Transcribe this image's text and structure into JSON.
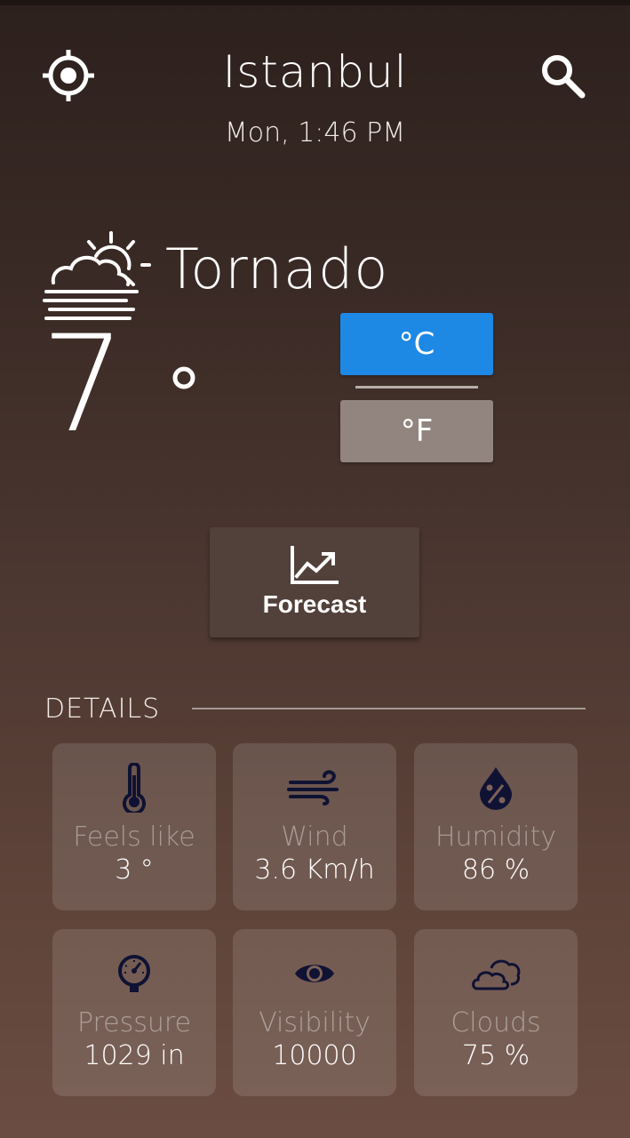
{
  "header": {
    "city": "Istanbul",
    "datetime": "Mon, 1:46 PM",
    "locate_icon": "my-location-icon",
    "search_icon": "search-icon"
  },
  "current": {
    "condition": "Tornado",
    "condition_icon": "sun-behind-fog-icon",
    "temperature": "7",
    "degree_symbol": "°"
  },
  "units": {
    "celsius_label": "°C",
    "fahrenheit_label": "°F",
    "selected": "celsius"
  },
  "forecast": {
    "label": "Forecast",
    "icon": "trending-chart-icon"
  },
  "details": {
    "title": "DETAILS",
    "items": [
      {
        "label": "Feels like",
        "value": "3 °",
        "icon": "thermometer-icon"
      },
      {
        "label": "Wind",
        "value": "3.6 Km/h",
        "icon": "wind-icon"
      },
      {
        "label": "Humidity",
        "value": "86 %",
        "icon": "humidity-drop-icon"
      },
      {
        "label": "Pressure",
        "value": "1029 in",
        "icon": "pressure-gauge-icon"
      },
      {
        "label": "Visibility",
        "value": "10000",
        "icon": "eye-icon"
      },
      {
        "label": "Clouds",
        "value": "75 %",
        "icon": "clouds-icon"
      }
    ]
  },
  "colors": {
    "celsius_active": "#1e88e5",
    "fahrenheit_inactive": "#928580",
    "icon_dark": "#0f1233"
  }
}
